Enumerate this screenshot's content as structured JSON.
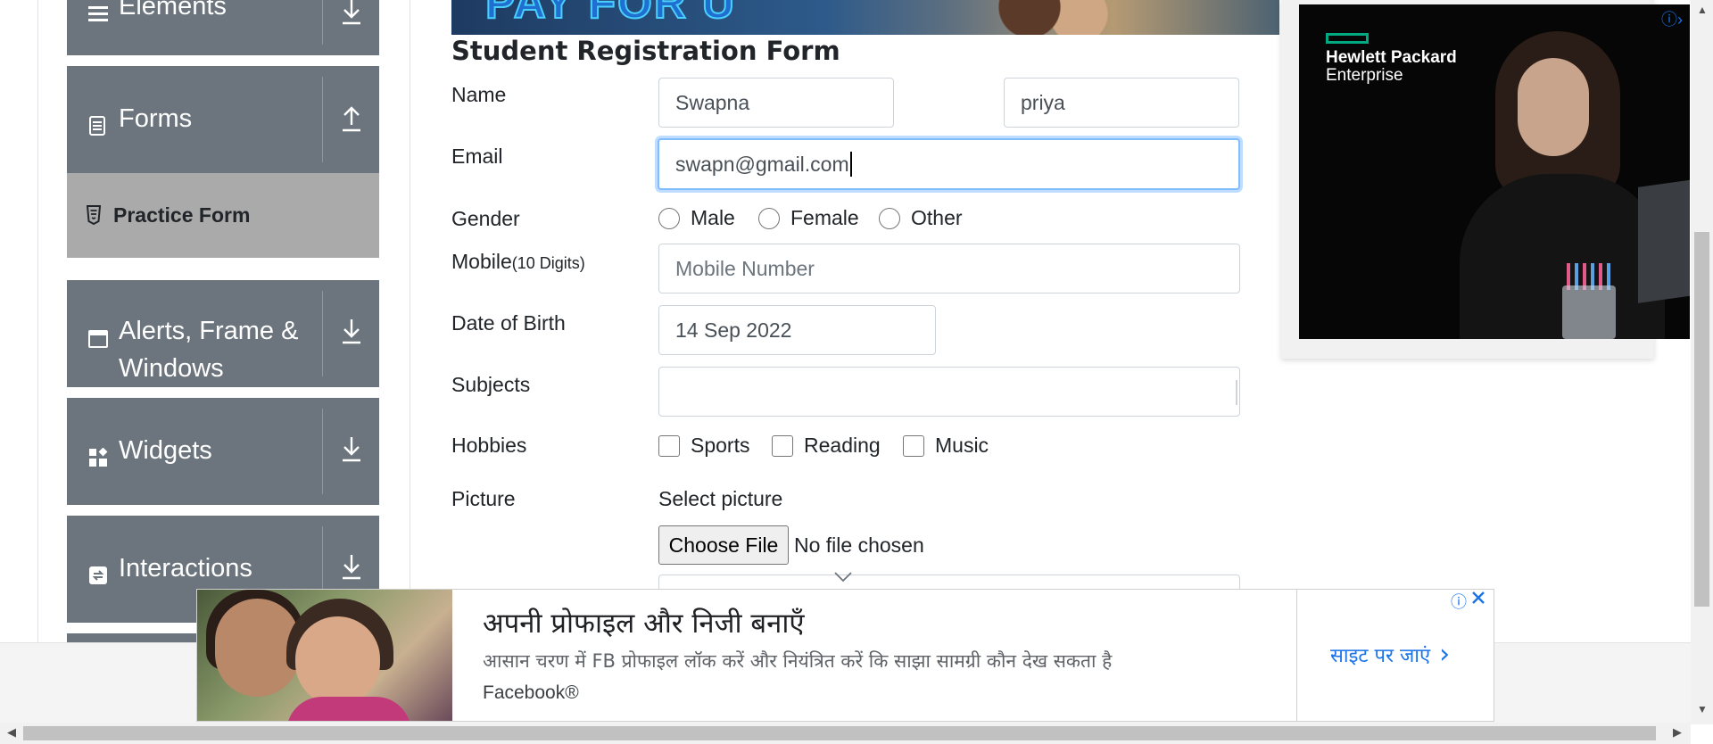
{
  "sidebar": {
    "groups": [
      {
        "label": "Elements",
        "icon": "hamburger-icon",
        "arrow": "download-arrow-icon"
      },
      {
        "label": "Forms",
        "icon": "document-icon",
        "arrow": "upload-arrow-icon"
      },
      {
        "label": "Alerts, Frame &",
        "label2": "Windows",
        "icon": "window-icon",
        "arrow": "download-arrow-icon"
      },
      {
        "label": "Widgets",
        "icon": "widgets-icon",
        "arrow": "download-arrow-icon"
      },
      {
        "label": "Interactions",
        "icon": "interactions-icon",
        "arrow": "download-arrow-icon"
      }
    ],
    "active_item": {
      "label": "Practice Form",
      "icon": "html5-icon"
    }
  },
  "form": {
    "title": "Student Registration Form",
    "name_label": "Name",
    "first_name_value": "Swapna",
    "last_name_value": "priya",
    "email_label": "Email",
    "email_value": "swapn@gmail.com",
    "gender_label": "Gender",
    "gender_options": [
      "Male",
      "Female",
      "Other"
    ],
    "mobile_label": "Mobile",
    "mobile_hint": "(10 Digits)",
    "mobile_placeholder": "Mobile Number",
    "dob_label": "Date of Birth",
    "dob_value": "14 Sep 2022",
    "subjects_label": "Subjects",
    "hobbies_label": "Hobbies",
    "hobbies_options": [
      "Sports",
      "Reading",
      "Music"
    ],
    "picture_label": "Picture",
    "picture_sublabel": "Select picture",
    "file_button": "Choose File",
    "file_status": "No file chosen"
  },
  "ad_right": {
    "brand_line1": "Hewlett Packard",
    "brand_line2": "Enterprise",
    "info_icon": "info-icon",
    "close_icon": "close-chevron-icon"
  },
  "ad_bottom": {
    "title": "अपनी प्रोफाइल और निजी बनाएँ",
    "description": "आसान चरण में FB प्रोफाइल लॉक करें और नियंत्रित करें कि साझा सामग्री कौन देख सकता है",
    "brand": "Facebook®",
    "cta": "साइट पर जाएं"
  },
  "colors": {
    "sidebar_bg": "#6c757d",
    "active_item_bg": "#aaaaaa",
    "focus_border": "#80bdff",
    "ad_link": "#1a73e8"
  }
}
